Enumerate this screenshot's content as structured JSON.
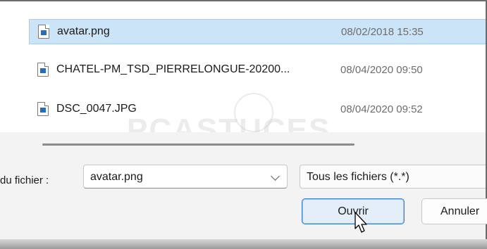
{
  "files": [
    {
      "name": "avatar.png",
      "date": "08/02/2018 15:35",
      "selected": true,
      "icon": "image-file-icon"
    },
    {
      "name": "CHATEL-PM_TSD_PIERRELONGUE-20200...",
      "date": "08/04/2020 09:50",
      "selected": false,
      "icon": "image-file-icon"
    },
    {
      "name": "DSC_0047.JPG",
      "date": "08/04/2020 09:52",
      "selected": false,
      "icon": "image-file-icon"
    }
  ],
  "watermark": {
    "text": "PCASTUCES"
  },
  "footer": {
    "filename_label": "du fichier :",
    "filename_value": "avatar.png",
    "filetype_value": "Tous les fichiers (*.*)",
    "open_label": "Ouvrir",
    "cancel_label": "Annuler"
  },
  "colors": {
    "selection_bg": "#cce4f7",
    "accent": "#3d7fc4",
    "footer_bg": "#f3f3f3"
  }
}
